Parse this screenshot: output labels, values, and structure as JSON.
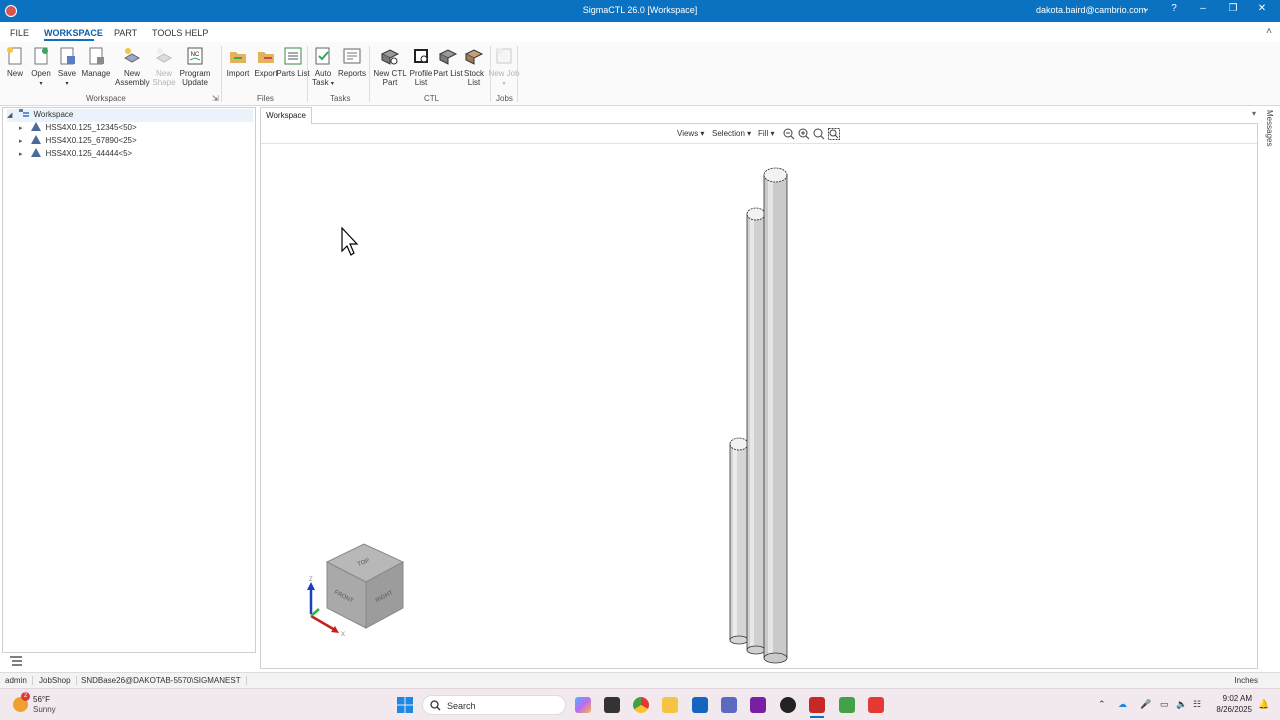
{
  "window": {
    "title": "SigmaCTL 26.0 [Workspace]",
    "user": "dakota.baird@cambrio.com",
    "help": "?",
    "minimize": "–",
    "maximize": "❐",
    "close": "✕"
  },
  "ribbon_tabs": [
    "FILE",
    "WORKSPACE",
    "PART",
    "TOOLS HELP"
  ],
  "ribbon_collapse": "˄",
  "ribbon": {
    "groups": [
      {
        "label": "Workspace",
        "buttons": [
          {
            "label": "New",
            "icon": "new-file-icon"
          },
          {
            "label": "Open",
            "icon": "open-file-icon"
          },
          {
            "label": "Save",
            "icon": "save-icon"
          },
          {
            "label": "Manage",
            "icon": "manage-icon"
          },
          {
            "label": "New Assembly",
            "icon": "new-assembly-icon"
          },
          {
            "label": "New Shape",
            "icon": "new-shape-icon",
            "disabled": true
          },
          {
            "label": "Program Update",
            "icon": "nc-program-icon"
          }
        ]
      },
      {
        "label": "Files",
        "buttons": [
          {
            "label": "Import",
            "icon": "import-icon"
          },
          {
            "label": "Export",
            "icon": "export-icon"
          },
          {
            "label": "Parts List",
            "icon": "parts-list-icon"
          }
        ]
      },
      {
        "label": "Tasks",
        "buttons": [
          {
            "label": "Auto Task",
            "icon": "auto-task-icon"
          },
          {
            "label": "Reports",
            "icon": "reports-icon"
          }
        ]
      },
      {
        "label": "CTL",
        "buttons": [
          {
            "label": "New CTL Part",
            "icon": "ctl-part-icon"
          },
          {
            "label": "Profile List",
            "icon": "profile-list-icon"
          },
          {
            "label": "Part List",
            "icon": "part-list-icon"
          },
          {
            "label": "Stock List",
            "icon": "stock-list-icon"
          }
        ]
      },
      {
        "label": "Jobs",
        "buttons": [
          {
            "label": "New Job",
            "icon": "new-job-icon",
            "disabled": true
          }
        ]
      }
    ]
  },
  "tree": {
    "root": "Workspace",
    "items": [
      "HSS4X0.125_12345<50>",
      "HSS4X0.125_67890<25>",
      "HSS4X0.125_44444<5>"
    ]
  },
  "viewport": {
    "tab": "Workspace",
    "toolbar": {
      "views": "Views",
      "selection": "Selection",
      "fill": "Fill"
    },
    "cube_faces": {
      "top": "TOP",
      "front": "FRONT",
      "right": "RIGHT"
    },
    "axes": {
      "x": "X",
      "z": "Z"
    }
  },
  "side_panel": "Messages",
  "statusbar": {
    "user": "admin",
    "mode": "JobShop",
    "database": "SNDBase26@DAKOTAB-5570\\SIGMANEST",
    "units": "Inches"
  },
  "taskbar": {
    "weather_temp": "56°F",
    "weather_desc": "Sunny",
    "weather_badge": "2",
    "search_placeholder": "Search",
    "time": "9:02 AM",
    "date": "8/26/2025",
    "apps": [
      "copilot-icon",
      "terminal-icon",
      "chrome-icon",
      "file-explorer-icon",
      "store-icon",
      "teams-icon",
      "onenote-icon",
      "sigma-app-icon",
      "sigmanest-icon",
      "green-app-icon",
      "red-app-icon"
    ]
  },
  "colors": {
    "titlebar": "#0b72c2",
    "accent": "#0b5ea8",
    "cylinder_fill": "#d8d8d8",
    "taskbar": "#f2e9ef"
  }
}
